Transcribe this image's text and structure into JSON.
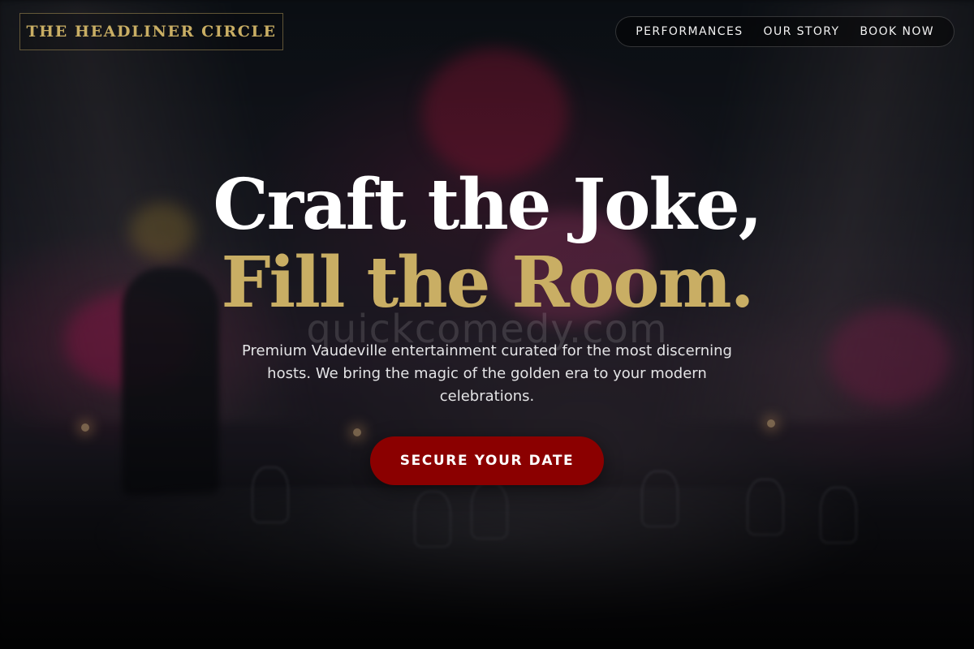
{
  "header": {
    "brand": "THE HEADLINER CIRCLE",
    "nav": [
      {
        "label": "PERFORMANCES"
      },
      {
        "label": "OUR STORY"
      },
      {
        "label": "BOOK NOW"
      }
    ]
  },
  "hero": {
    "headline_line1": "Craft the Joke,",
    "headline_line2": "Fill the Room.",
    "tagline": "Premium Vaudeville entertainment curated for the most discerning hosts. We bring the magic of the golden era to your modern celebrations.",
    "cta_label": "SECURE YOUR DATE"
  },
  "watermark": "quickcomedy.com",
  "colors": {
    "accent_gold": "#c9ae64",
    "cta_red": "#8b0000",
    "background": "#0b0d11"
  }
}
